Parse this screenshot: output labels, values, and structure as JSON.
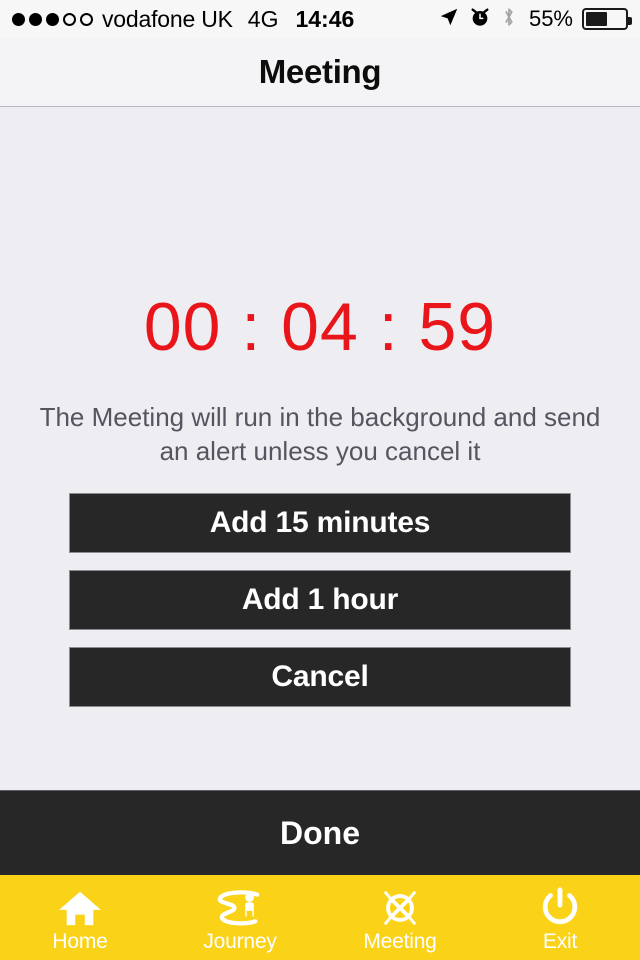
{
  "status_bar": {
    "signal_dots": [
      true,
      true,
      true,
      false,
      false
    ],
    "carrier": "vodafone UK",
    "network": "4G",
    "time": "14:46",
    "battery_percent": "55%",
    "battery_level": 55,
    "icons": [
      "location-arrow-icon",
      "alarm-clock-icon",
      "bluetooth-icon"
    ]
  },
  "nav": {
    "title": "Meeting"
  },
  "main": {
    "timer": "00 : 04 : 59",
    "timer_color": "#e8161a",
    "description": "The Meeting will run in the background and send an alert unless you cancel it",
    "buttons": [
      {
        "label": "Add 15 minutes",
        "name": "add-15-minutes-button"
      },
      {
        "label": "Add 1 hour",
        "name": "add-1-hour-button"
      },
      {
        "label": "Cancel",
        "name": "cancel-button"
      }
    ]
  },
  "done_bar": {
    "label": "Done"
  },
  "tab_bar": {
    "background_color": "#fad218",
    "items": [
      {
        "label": "Home",
        "icon": "home-icon"
      },
      {
        "label": "Journey",
        "icon": "journey-icon"
      },
      {
        "label": "Meeting",
        "icon": "meeting-burst-icon"
      },
      {
        "label": "Exit",
        "icon": "power-icon"
      }
    ]
  }
}
